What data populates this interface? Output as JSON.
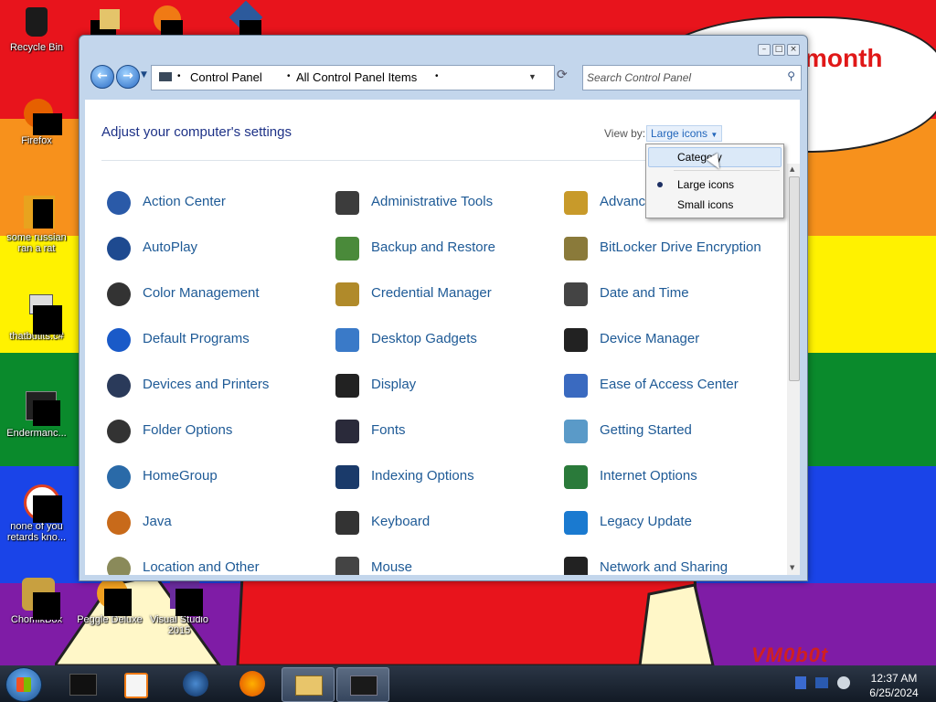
{
  "desktop": {
    "bubble_text": "month",
    "watermark": "VM0b0t",
    "icons": [
      {
        "label": "Recycle Bin"
      },
      {
        "label": "Firefox"
      },
      {
        "label": "some russian ran a rat"
      },
      {
        "label": "thatbutits.c#"
      },
      {
        "label": "Endermanc..."
      },
      {
        "label": "none of you retards kno..."
      },
      {
        "label": "ChomikBox"
      },
      {
        "label": "Peggle Deluxe"
      },
      {
        "label": "Visual Studio 2015"
      }
    ]
  },
  "window": {
    "breadcrumb": [
      "Control Panel",
      "All Control Panel Items"
    ],
    "search_placeholder": "Search Control Panel",
    "heading": "Adjust your computer's settings",
    "view_by_label": "View by:",
    "view_by_value": "Large icons",
    "items": [
      {
        "label": "Action Center",
        "icon": "shield-flag-icon"
      },
      {
        "label": "Administrative Tools",
        "icon": "admin-tools-icon"
      },
      {
        "label": "Advanc",
        "icon": "users-icon"
      },
      {
        "label": "AutoPlay",
        "icon": "autoplay-icon"
      },
      {
        "label": "Backup and Restore",
        "icon": "backup-icon"
      },
      {
        "label": "BitLocker Drive Encryption",
        "icon": "keys-icon"
      },
      {
        "label": "Color Management",
        "icon": "monitor-icon"
      },
      {
        "label": "Credential Manager",
        "icon": "vault-icon"
      },
      {
        "label": "Date and Time",
        "icon": "calendar-icon"
      },
      {
        "label": "Default Programs",
        "icon": "default-programs-icon"
      },
      {
        "label": "Desktop Gadgets",
        "icon": "gadgets-icon"
      },
      {
        "label": "Device Manager",
        "icon": "device-manager-icon"
      },
      {
        "label": "Devices and Printers",
        "icon": "printer-icon"
      },
      {
        "label": "Display",
        "icon": "display-icon"
      },
      {
        "label": "Ease of Access Center",
        "icon": "ease-of-access-icon"
      },
      {
        "label": "Folder Options",
        "icon": "folder-options-icon"
      },
      {
        "label": "Fonts",
        "icon": "fonts-icon"
      },
      {
        "label": "Getting Started",
        "icon": "getting-started-icon"
      },
      {
        "label": "HomeGroup",
        "icon": "homegroup-icon"
      },
      {
        "label": "Indexing Options",
        "icon": "indexing-icon"
      },
      {
        "label": "Internet Options",
        "icon": "internet-options-icon"
      },
      {
        "label": "Java",
        "icon": "java-icon"
      },
      {
        "label": "Keyboard",
        "icon": "keyboard-icon"
      },
      {
        "label": "Legacy Update",
        "icon": "update-arrow-icon"
      },
      {
        "label": "Location and Other",
        "icon": "location-icon"
      },
      {
        "label": "Mouse",
        "icon": "mouse-icon"
      },
      {
        "label": "Network and Sharing",
        "icon": "network-icon"
      }
    ]
  },
  "view_menu": {
    "options": [
      "Category",
      "Large icons",
      "Small icons"
    ],
    "selected": "Large icons",
    "hovered": "Category"
  },
  "taskbar": {
    "time": "12:37 AM",
    "date": "6/25/2024"
  },
  "colors": {
    "link_text": "#1e5a96",
    "heading_text": "#1e3287",
    "bubble_text": "#e01818"
  }
}
